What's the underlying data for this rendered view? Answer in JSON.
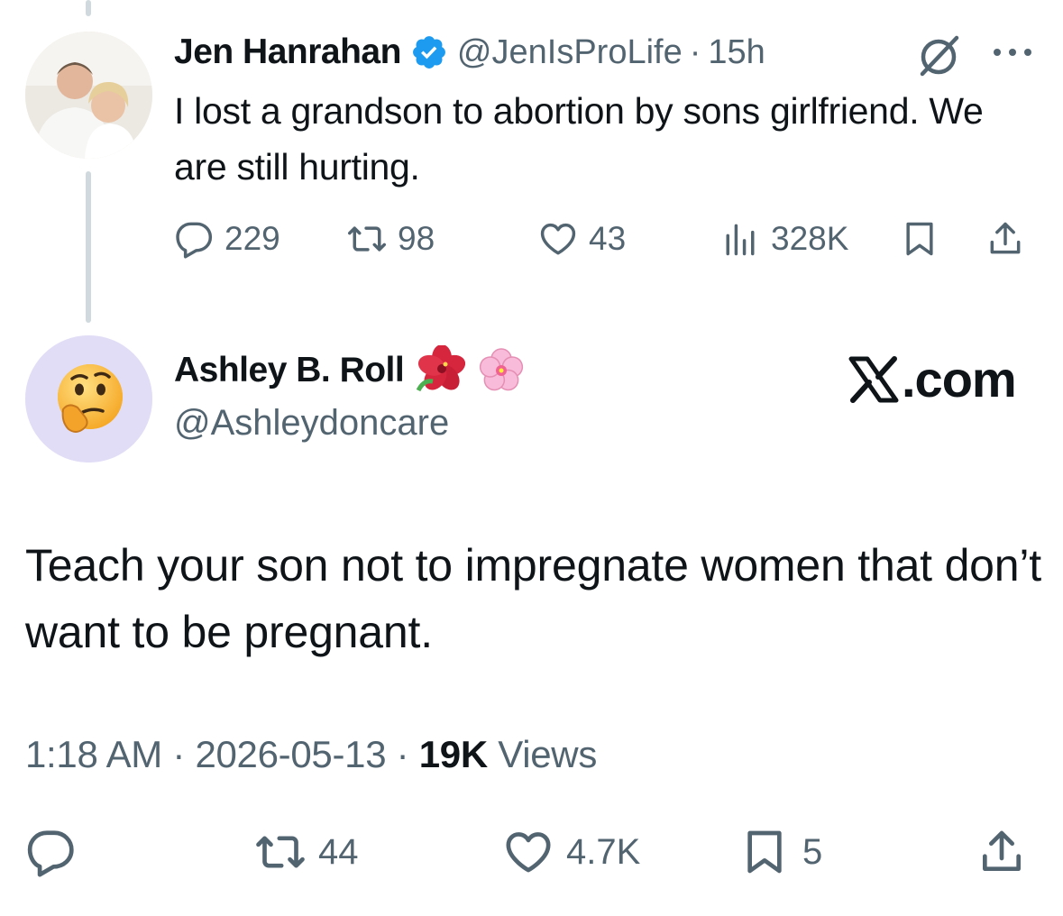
{
  "parent_tweet": {
    "author_name": "Jen Hanrahan",
    "handle": "@JenIsProLife",
    "separator": "·",
    "time": "15h",
    "text": "I lost a grandson to abortion by sons girlfriend. We are still hurting.",
    "replies": "229",
    "reposts": "98",
    "likes": "43",
    "views": "328K",
    "icons": [
      "verified-badge-icon",
      "grok-icon",
      "more-icon",
      "reply-icon",
      "repost-icon",
      "like-icon",
      "views-icon",
      "bookmark-icon",
      "share-icon"
    ]
  },
  "main_tweet": {
    "author_name": "Ashley B. Roll",
    "handle": "@Ashleydoncare",
    "name_emojis": [
      "hibiscus-icon",
      "cherry-blossom-icon"
    ],
    "avatar_emoji": "thinking-face-icon",
    "site": ".com",
    "text": "Teach your son not to impregnate women that don’t want to be pregnant.",
    "time": "1:18 AM",
    "sep1": "·",
    "date": "2026-05-13",
    "sep2": "·",
    "views_count": "19K",
    "views_label": "Views",
    "reposts": "44",
    "likes": "4.7K",
    "bookmarks": "5"
  },
  "colors": {
    "text": "#0f1419",
    "secondary": "#536471",
    "verified": "#1d9bf0",
    "thread_line": "#cfd9de",
    "avatar_bg": "#e2ddf7"
  }
}
